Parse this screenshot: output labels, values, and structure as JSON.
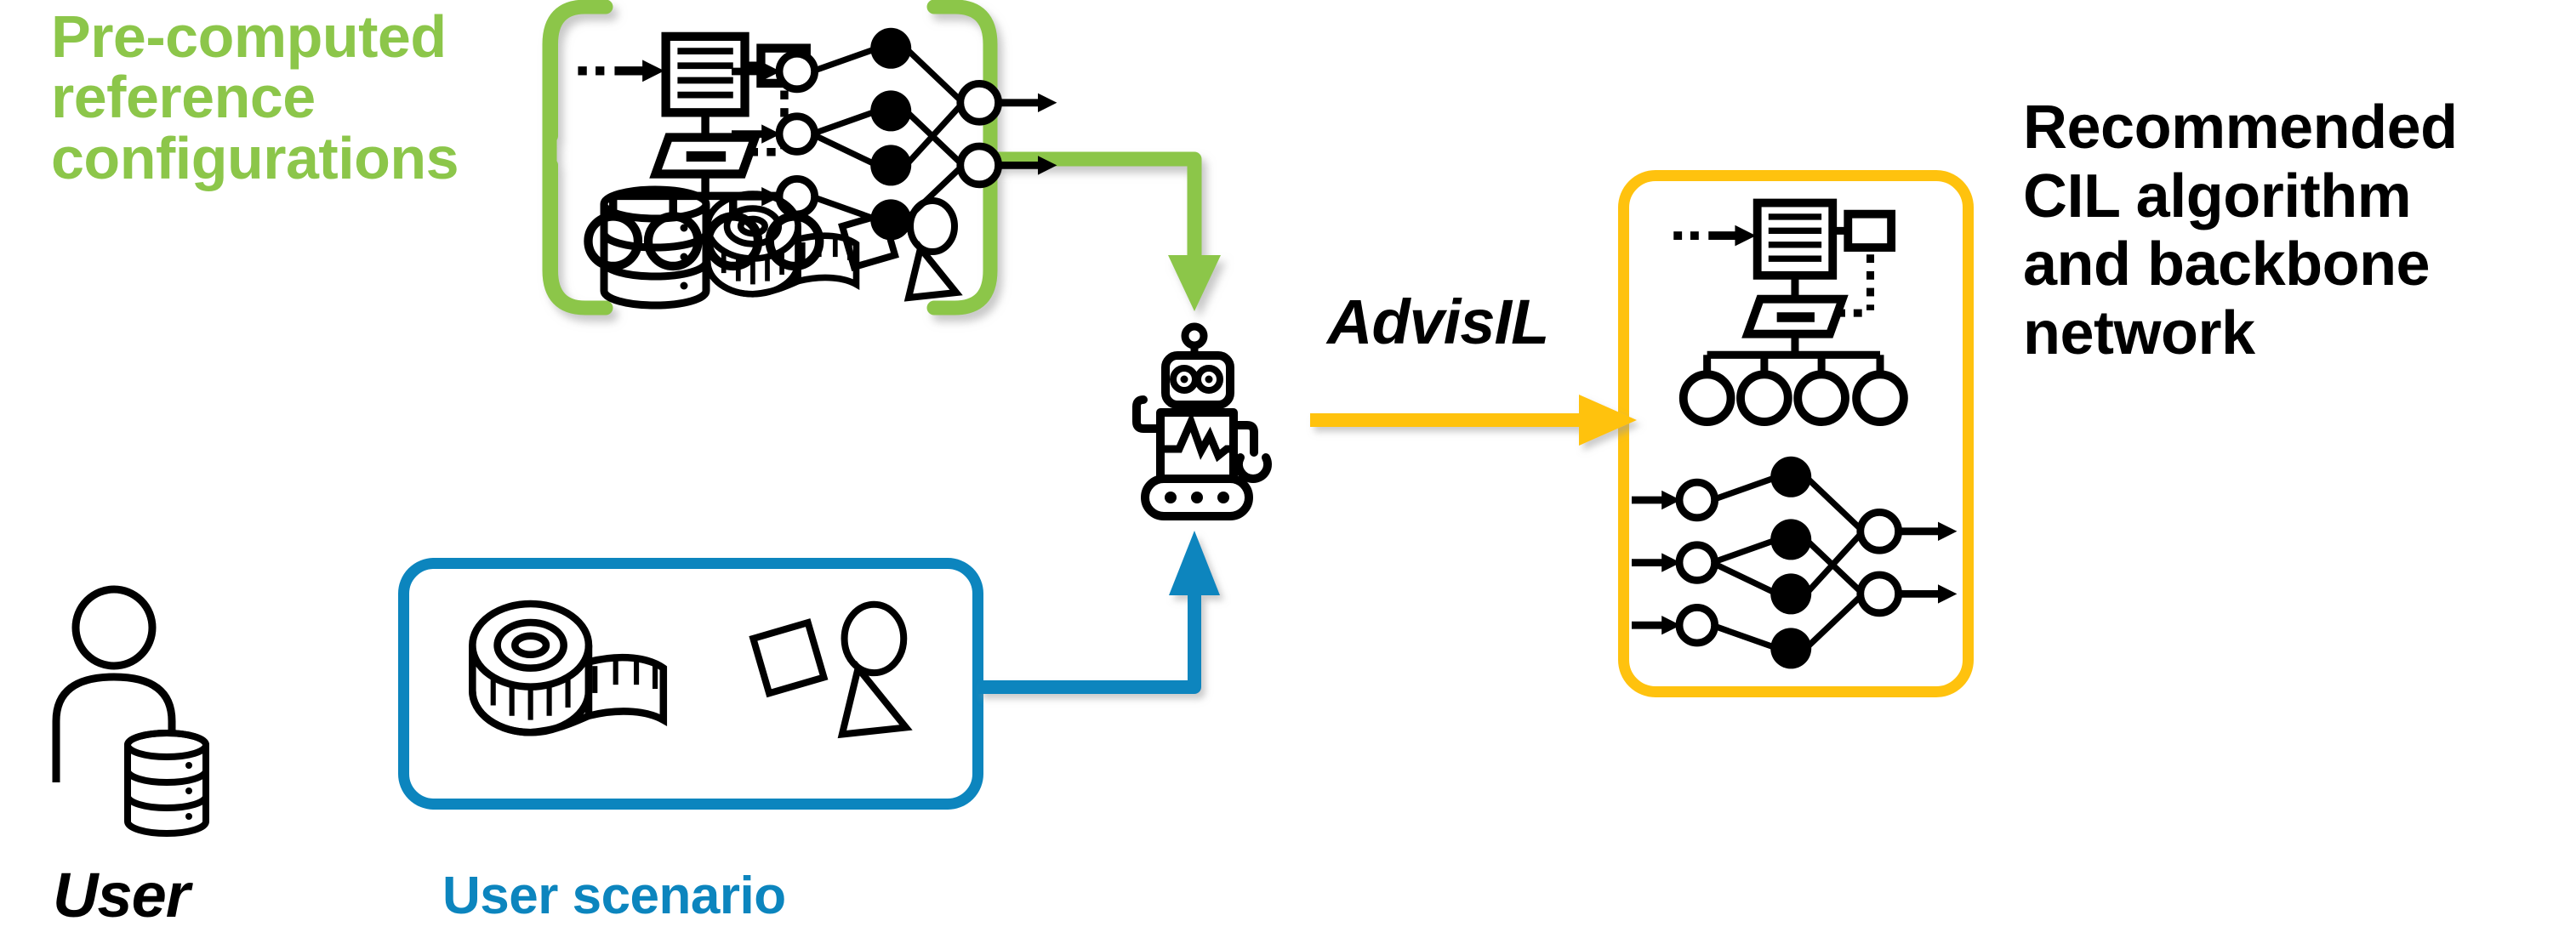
{
  "diagram": {
    "title": "AdvisIL recommendation pipeline overview",
    "background_color": "#FFFFFF"
  },
  "colors": {
    "green": "#8CC64A",
    "blue": "#0C85BE",
    "yellow": "#FFC20E",
    "black": "#000000",
    "white": "#FFFFFF"
  },
  "labels": {
    "reference_line1": "Pre-computed",
    "reference_line2": "reference",
    "reference_line3": "configurations",
    "method_name": "AdvisIL",
    "user": "User",
    "user_scenario": "User scenario",
    "output_line1": "Recommended",
    "output_line2": "CIL algorithm",
    "output_line3": "and backbone",
    "output_line4": "network"
  },
  "nodes": {
    "reference_bracket": {
      "name": "Pre-computed reference configurations",
      "color": "#8CC64A",
      "style": "rounded-bracket",
      "icons": [
        "algorithm-flowchart-icon",
        "neural-network-icon",
        "database-cylinder-icon",
        "measuring-tape-icon",
        "geometric-shapes-icon"
      ]
    },
    "user": {
      "name": "User",
      "icons": [
        "person-icon",
        "database-cylinder-icon"
      ]
    },
    "user_scenario_box": {
      "name": "User scenario",
      "color": "#0C85BE",
      "style": "rounded-rectangle",
      "icons": [
        "measuring-tape-icon",
        "geometric-shapes-icon"
      ]
    },
    "advisil_robot": {
      "name": "AdvisIL robot recommender",
      "icons": [
        "robot-icon"
      ]
    },
    "output_box": {
      "name": "Recommended CIL algorithm and backbone network",
      "color": "#FFC20E",
      "style": "rounded-rectangle",
      "icons": [
        "algorithm-flowchart-icon",
        "neural-network-icon"
      ]
    }
  },
  "edges": [
    {
      "from": "reference_bracket",
      "to": "advisil_robot",
      "color": "#8CC64A",
      "route": "right-then-down",
      "arrowhead": "down"
    },
    {
      "from": "user_scenario_box",
      "to": "advisil_robot",
      "color": "#0C85BE",
      "route": "right-then-up",
      "arrowhead": "up"
    },
    {
      "from": "user",
      "to": "user_scenario_box",
      "color": "#0C85BE",
      "route": "straight-right",
      "arrowhead": "none"
    },
    {
      "from": "advisil_robot",
      "to": "output_box",
      "color": "#FFC20E",
      "route": "straight-right",
      "arrowhead": "right",
      "label": "AdvisIL"
    }
  ],
  "icon_details": {
    "neural_network": {
      "input_nodes": 3,
      "hidden_nodes": 4,
      "output_nodes": 2,
      "input_fill": "white",
      "hidden_fill": "black",
      "output_fill": "white"
    },
    "algorithm_flowchart": {
      "shapes": [
        "document",
        "small-rectangle",
        "parallelogram",
        "four-circles"
      ],
      "leaf_circles": 4
    },
    "database_cylinder": {
      "bands": 3,
      "dots": 3
    },
    "geometric_shapes": [
      "square",
      "circle",
      "triangle"
    ],
    "robot": {
      "antenna": true,
      "eyes": 2,
      "arms": 2,
      "base_dots": 3,
      "chest": "waveform"
    }
  }
}
